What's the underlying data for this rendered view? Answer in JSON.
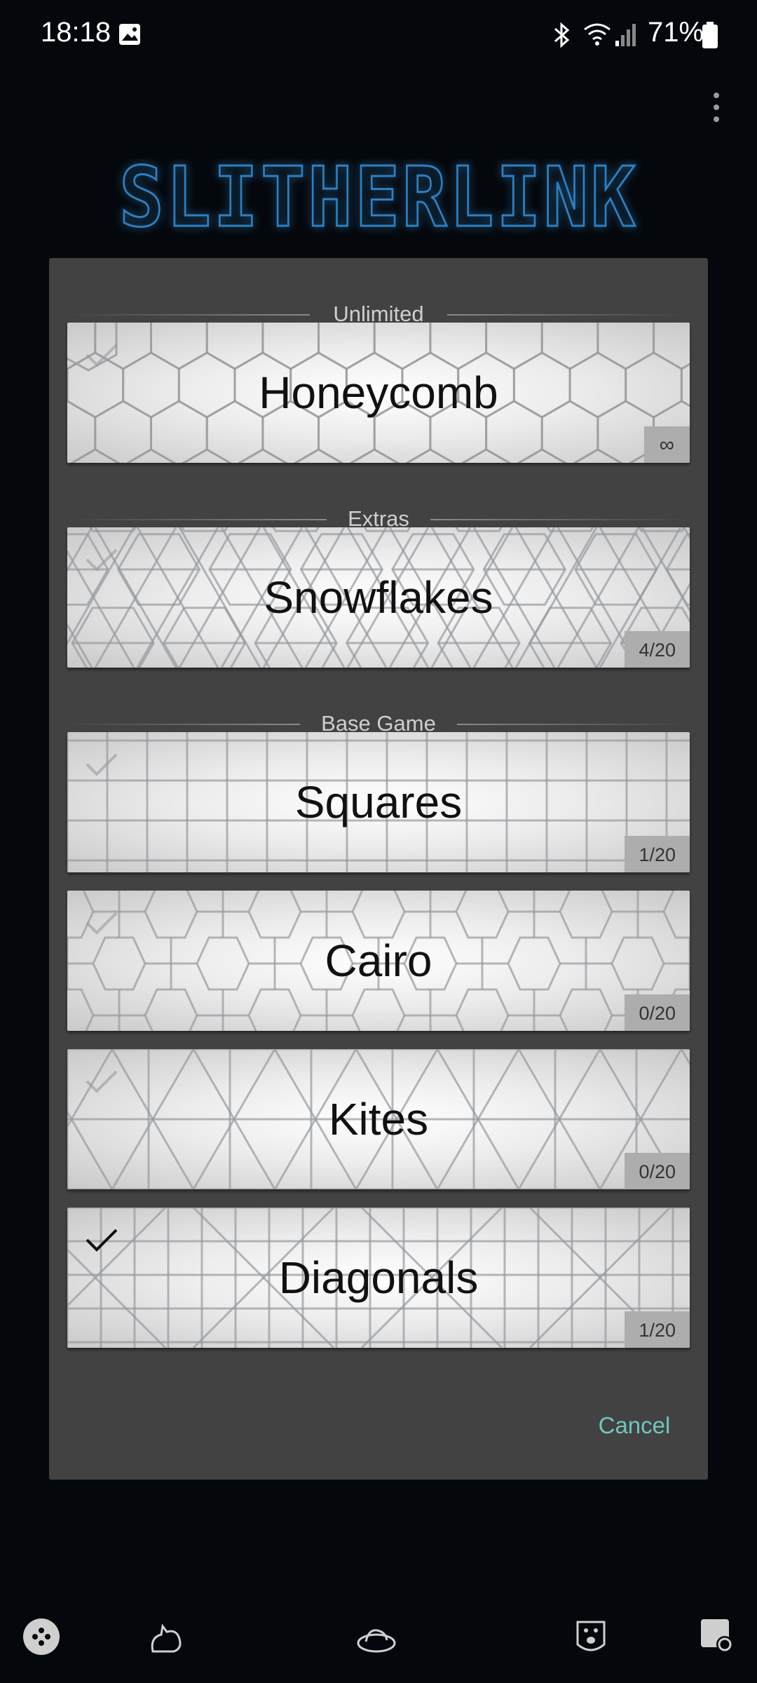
{
  "status_bar": {
    "time": "18:18",
    "battery": "71%",
    "icons": [
      "gallery-icon",
      "bluetooth-icon",
      "wifi-icon",
      "signal-icon",
      "battery-icon"
    ]
  },
  "app": {
    "logo_text": "SLITHERLINK",
    "menu_icon": "more-vert-icon"
  },
  "dialog": {
    "sections": [
      {
        "label": "Unlimited"
      },
      {
        "label": "Extras"
      },
      {
        "label": "Base Game"
      }
    ],
    "cards": [
      {
        "title": "Honeycomb",
        "progress": "∞",
        "checked": false,
        "pattern": "hexagon"
      },
      {
        "title": "Snowflakes",
        "progress": "4/20",
        "checked": false,
        "pattern": "snowflake"
      },
      {
        "title": "Squares",
        "progress": "1/20",
        "checked": false,
        "pattern": "square"
      },
      {
        "title": "Cairo",
        "progress": "0/20",
        "checked": false,
        "pattern": "cairo"
      },
      {
        "title": "Kites",
        "progress": "0/20",
        "checked": false,
        "pattern": "kite"
      },
      {
        "title": "Diagonals",
        "progress": "1/20",
        "checked": true,
        "pattern": "diagonal"
      }
    ],
    "cancel_label": "Cancel"
  },
  "bottom_nav": {
    "items": [
      "gamepad-icon",
      "cat-icon",
      "cat-bed-icon",
      "paw-icon",
      "settings-icon"
    ]
  },
  "colors": {
    "background": "#04070b",
    "dialog": "#424242",
    "accent": "#6fc6bd",
    "logo": "#2f7fc0"
  }
}
